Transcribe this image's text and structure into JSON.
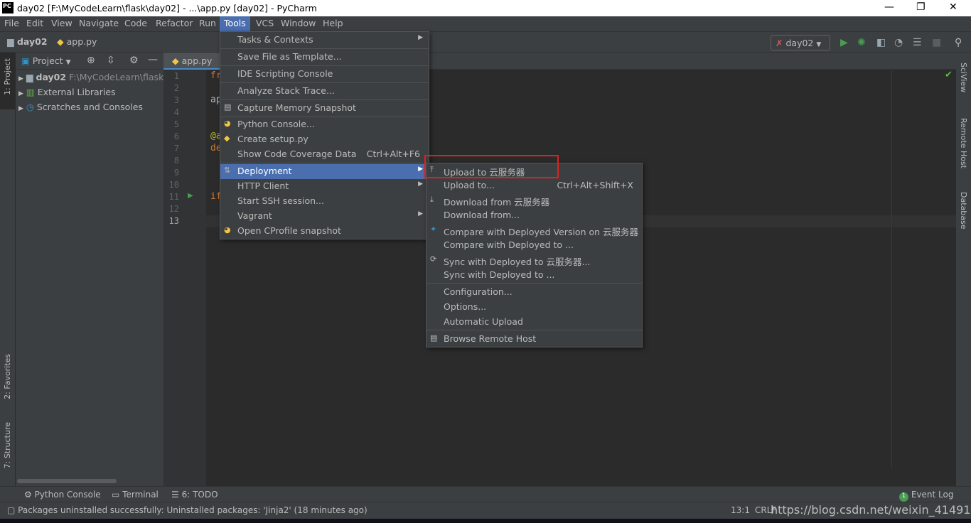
{
  "window": {
    "title": "day02 [F:\\MyCodeLearn\\flask\\day02] - ...\\app.py [day02] - PyCharm",
    "logo": "PC"
  },
  "menubar": [
    "File",
    "Edit",
    "View",
    "Navigate",
    "Code",
    "Refactor",
    "Run",
    "Tools",
    "VCS",
    "Window",
    "Help"
  ],
  "breadcrumb": {
    "project": "day02",
    "file": "app.py"
  },
  "run_config": {
    "name": "day02"
  },
  "project_panel": {
    "title": "Project",
    "tree": [
      {
        "label": "day02",
        "path": "F:\\MyCodeLearn\\flask"
      },
      {
        "label": "External Libraries"
      },
      {
        "label": "Scratches and Consoles"
      }
    ]
  },
  "left_strip": {
    "project": "1: Project",
    "favorites": "2: Favorites",
    "structure": "7: Structure"
  },
  "right_strip": {
    "sciview": "SciView",
    "remote": "Remote Host",
    "database": "Database"
  },
  "editor": {
    "tab": "app.py",
    "lines": [
      "1",
      "2",
      "3",
      "4",
      "5",
      "6",
      "7",
      "8",
      "9",
      "10",
      "11",
      "12",
      "13"
    ],
    "code": [
      {
        "line": 1,
        "text": "fr",
        "color": "#cc7832"
      },
      {
        "line": 3,
        "text": "ap",
        "color": "#a9b7c6"
      },
      {
        "line": 6,
        "text": "@a",
        "color": "#bbb529"
      },
      {
        "line": 7,
        "text": "de",
        "color": "#cc7832"
      },
      {
        "line": 11,
        "text": "if",
        "color": "#cc7832"
      }
    ]
  },
  "tools_menu": [
    {
      "label": "Tasks & Contexts",
      "arrow": true
    },
    {
      "label": "Save File as Template..."
    },
    {
      "label": "IDE Scripting Console"
    },
    {
      "label": "Analyze Stack Trace..."
    },
    {
      "label": "Capture Memory Snapshot",
      "icon": "memory-icon"
    },
    {
      "label": "Python Console...",
      "icon": "python-icon"
    },
    {
      "label": "Create setup.py",
      "icon": "python-file-icon"
    },
    {
      "label": "Show Code Coverage Data",
      "shortcut": "Ctrl+Alt+F6"
    },
    {
      "label": "Deployment",
      "icon": "deployment-icon",
      "arrow": true,
      "selected": true
    },
    {
      "label": "HTTP Client",
      "arrow": true
    },
    {
      "label": "Start SSH session..."
    },
    {
      "label": "Vagrant",
      "arrow": true
    },
    {
      "label": "Open CProfile snapshot",
      "icon": "python-icon"
    }
  ],
  "deployment_menu": [
    {
      "label": "Upload to 云服务器",
      "icon": "upload-icon",
      "highlighted": true
    },
    {
      "label": "Upload to...",
      "shortcut": "Ctrl+Alt+Shift+X"
    },
    {
      "label": "Download from 云服务器",
      "icon": "download-icon"
    },
    {
      "label": "Download from..."
    },
    {
      "label": "Compare with Deployed Version on 云服务器",
      "icon": "compare-icon"
    },
    {
      "label": "Compare with Deployed to ..."
    },
    {
      "label": "Sync with Deployed to 云服务器...",
      "icon": "sync-icon"
    },
    {
      "label": "Sync with Deployed to ..."
    },
    {
      "label": "Configuration..."
    },
    {
      "label": "Options..."
    },
    {
      "label": "Automatic Upload"
    },
    {
      "label": "Browse Remote Host",
      "icon": "server-icon"
    }
  ],
  "bottom_tools": {
    "python_console": "Python Console",
    "terminal": "Terminal",
    "todo": "6: TODO",
    "event_log": "Event Log",
    "event_count": "1"
  },
  "status": {
    "message": "Packages uninstalled successfully: Uninstalled packages: 'Jinja2' (18 minutes ago)",
    "position": "13:1",
    "line_sep": "CRLF",
    "watermark": "https://blog.csdn.net/weixin_41491142"
  },
  "colors": {
    "accent": "#4b6eaf",
    "highlight_box": "#e0201a",
    "run": "#499c54"
  }
}
